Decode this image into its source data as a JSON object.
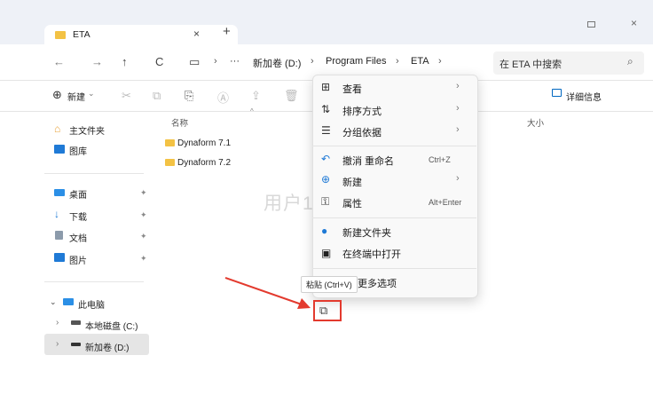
{
  "tab": {
    "title": "ETA",
    "close": "×",
    "new": "+"
  },
  "window": {
    "close": "×"
  },
  "nav": {
    "back": "←",
    "forward": "→",
    "up": "↑",
    "refresh": "C",
    "monitor": "▭",
    "chev": "›",
    "more": "···",
    "crumbs": [
      "新加卷 (D:)",
      "Program Files",
      "ETA"
    ]
  },
  "search": {
    "placeholder": "在 ETA 中搜索",
    "icon": "⌕"
  },
  "toolbar": {
    "new_label": "新建",
    "new_plus": "⊕",
    "details_label": "详细信息"
  },
  "sidebar": {
    "home": "主文件夹",
    "gallery": "图库",
    "quick": [
      {
        "label": "桌面"
      },
      {
        "label": "下载"
      },
      {
        "label": "文档"
      },
      {
        "label": "图片"
      }
    ],
    "this_pc": "此电脑",
    "drive_c": "本地磁盘 (C:)",
    "drive_d": "新加卷 (D:)"
  },
  "columns": {
    "name": "名称",
    "size": "大小"
  },
  "files": [
    {
      "name": "Dynaform 7.1"
    },
    {
      "name": "Dynaform 7.2"
    }
  ],
  "watermark": "用户11856980",
  "context_menu": {
    "items": [
      {
        "icon": "⊞",
        "label": "查看",
        "shortcut": "",
        "arrow": "›"
      },
      {
        "icon": "⇅",
        "label": "排序方式",
        "shortcut": "",
        "arrow": "›"
      },
      {
        "icon": "☰",
        "label": "分组依据",
        "shortcut": "",
        "arrow": "›"
      },
      {
        "icon": "↶",
        "label": "撤消 重命名",
        "shortcut": "Ctrl+Z",
        "arrow": ""
      },
      {
        "icon": "⊕",
        "label": "新建",
        "shortcut": "",
        "arrow": "›"
      },
      {
        "icon": "⚿",
        "label": "属性",
        "shortcut": "Alt+Enter",
        "arrow": ""
      },
      {
        "icon": "●",
        "label": "新建文件夹",
        "shortcut": "",
        "arrow": ""
      },
      {
        "icon": "▣",
        "label": "在终端中打开",
        "shortcut": "",
        "arrow": ""
      },
      {
        "icon": "",
        "label": "更多选项",
        "shortcut": "",
        "arrow": ""
      }
    ],
    "tooltip": "粘贴 (Ctrl+V)",
    "paste_icon": "⧉"
  },
  "colors": {
    "accent": "#0067c0",
    "annotation": "#e33a2e",
    "folder": "#f3c244"
  }
}
